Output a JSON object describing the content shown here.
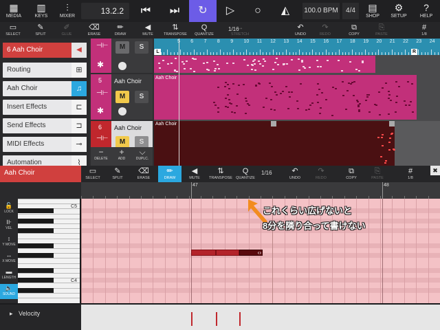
{
  "topbar": {
    "left_buttons": [
      {
        "label": "MEDIA",
        "icon": "media-icon",
        "glyph": "▦"
      },
      {
        "label": "KEYS",
        "icon": "keys-icon",
        "glyph": "▥"
      },
      {
        "label": "MIXER",
        "icon": "mixer-icon",
        "glyph": "⫶"
      }
    ],
    "position": "13.2.2",
    "tempo": "100.0 BPM",
    "signature": "4/4",
    "right_buttons": [
      {
        "label": "SHOP",
        "icon": "shop-icon",
        "glyph": "▤"
      },
      {
        "label": "SETUP",
        "icon": "gear-icon",
        "glyph": "⚙"
      },
      {
        "label": "HELP",
        "icon": "help-icon",
        "glyph": "?"
      }
    ]
  },
  "toolbar": {
    "items": [
      {
        "label": "SELECT",
        "glyph": "▭",
        "state": "normal"
      },
      {
        "label": "SPLIT",
        "glyph": "✎",
        "state": "normal"
      },
      {
        "label": "GLUE",
        "glyph": "✐",
        "state": "dim"
      },
      {
        "label": "ERASE",
        "glyph": "⌫",
        "state": "normal"
      },
      {
        "label": "DRAW",
        "glyph": "✏",
        "state": "normal"
      },
      {
        "label": "MUTE",
        "glyph": "◀",
        "state": "normal"
      },
      {
        "label": "TRANSPOSE",
        "glyph": "⇅",
        "state": "normal"
      },
      {
        "label": "QUANTIZE",
        "glyph": "Q",
        "state": "normal"
      },
      {
        "label": "STRETCH",
        "glyph": "↔",
        "state": "dim"
      },
      {
        "label": "UNDO",
        "glyph": "↶",
        "state": "normal"
      },
      {
        "label": "REDO",
        "glyph": "↷",
        "state": "dim"
      },
      {
        "label": "COPY",
        "glyph": "⧉",
        "state": "normal"
      },
      {
        "label": "PASTE",
        "glyph": "⎘",
        "state": "dim"
      },
      {
        "label": "1/8",
        "glyph": "#",
        "state": "normal"
      }
    ],
    "quantize_value": "1/16"
  },
  "inspector": {
    "track_title": "6  Aah Choir",
    "items": [
      {
        "label": "Routing",
        "icon": "routing-icon",
        "glyph": "⊞"
      },
      {
        "label": "Aah Choir",
        "icon": "instrument-icon",
        "glyph": "♫"
      },
      {
        "label": "Insert Effects",
        "icon": "fx-icon",
        "glyph": "⊏"
      },
      {
        "label": "Send Effects",
        "icon": "send-icon",
        "glyph": "⊐"
      },
      {
        "label": "MIDI Effects",
        "icon": "midi-fx-icon",
        "glyph": "⊸"
      },
      {
        "label": "Automation",
        "icon": "automation-icon",
        "glyph": "⌇"
      }
    ]
  },
  "tracks": [
    {
      "number": "",
      "name": "",
      "m": "M",
      "s": "S"
    },
    {
      "number": "5",
      "name": "Aah Choir",
      "m": "M",
      "s": "S"
    },
    {
      "number": "6",
      "name": "Aah Choir",
      "m": "M",
      "s": "S"
    }
  ],
  "track_tools": {
    "delete": "DELETE",
    "add": "ADD",
    "duplicate": "DUPLC."
  },
  "ruler": {
    "numbers": [
      "5",
      "6",
      "7",
      "8",
      "9",
      "10",
      "11",
      "12",
      "13",
      "14",
      "15",
      "16",
      "17",
      "18",
      "19",
      "20",
      "21",
      "22",
      "23",
      "24"
    ],
    "left_locator": "L",
    "right_locator": "R"
  },
  "clips": {
    "track5_title": "Aah Choir",
    "track6_title": "Aah Choir"
  },
  "editor": {
    "track_name": "Aah Choir",
    "tools": [
      {
        "label": "SELECT",
        "glyph": "▭",
        "state": "normal"
      },
      {
        "label": "SPLIT",
        "glyph": "✎",
        "state": "normal"
      },
      {
        "label": "ERASE",
        "glyph": "⌫",
        "state": "normal"
      },
      {
        "label": "DRAW",
        "glyph": "✏",
        "state": "active"
      },
      {
        "label": "MUTE",
        "glyph": "◀",
        "state": "normal"
      },
      {
        "label": "TRANSPOSE",
        "glyph": "⇅",
        "state": "normal"
      },
      {
        "label": "QUANTIZE",
        "glyph": "Q",
        "state": "normal"
      },
      {
        "label": "UNDO",
        "glyph": "↶",
        "state": "normal"
      },
      {
        "label": "REDO",
        "glyph": "↷",
        "state": "dim"
      },
      {
        "label": "COPY",
        "glyph": "⧉",
        "state": "normal"
      },
      {
        "label": "PASTE",
        "glyph": "⎘",
        "state": "dim"
      },
      {
        "label": "1/8",
        "glyph": "#",
        "state": "normal"
      }
    ],
    "quantize_value": "1/16",
    "close_glyph": "✖",
    "ruler_numbers": [
      "47",
      "48"
    ],
    "keys": [
      "C5",
      "C4"
    ],
    "side_buttons": [
      {
        "label": "LOCK",
        "glyph": "🔓",
        "active": false
      },
      {
        "label": "VEL",
        "glyph": "⊪",
        "active": false
      },
      {
        "label": "Y MOVE",
        "glyph": "↕",
        "active": false
      },
      {
        "label": "X MOVE",
        "glyph": "↔",
        "active": false
      },
      {
        "label": "LENGTH",
        "glyph": "▬",
        "active": false
      },
      {
        "label": "SOUND",
        "glyph": "🔈",
        "active": true
      }
    ],
    "selected_note_handle": "‹›",
    "velocity_label": "Velocity",
    "velocity_arrow": "▸"
  },
  "annotation": {
    "line1": "これくらい広げないと",
    "line2": "8分を隣り合って書けない",
    "arrow_color": "#f28c1f"
  },
  "colors": {
    "accent_blue": "#2ba8e0",
    "track_red": "#d0403e",
    "clip_magenta": "#c2307a",
    "cycle_purple": "#6c5ce7"
  }
}
